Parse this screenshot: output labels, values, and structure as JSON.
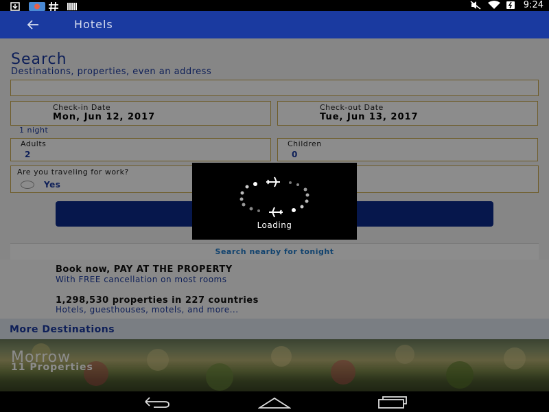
{
  "status_bar": {
    "time": "9:24",
    "icons": [
      "download-icon",
      "photos-icon",
      "hashtag-icon",
      "barcode-icon",
      "mute-icon",
      "wifi-icon",
      "battery-icon"
    ]
  },
  "app_bar": {
    "title": "Hotels",
    "back_icon": "arrow-left-icon",
    "color": "#1a3aa0"
  },
  "search": {
    "title": "Search",
    "subtitle": "Destinations, properties, even an address",
    "destination_value": "",
    "checkin_label": "Check-in Date",
    "checkin_value": "Mon, Jun 12, 2017",
    "checkout_label": "Check-out Date",
    "checkout_value": "Tue, Jun 13, 2017",
    "nights": "1 night",
    "adults_label": "Adults",
    "adults_value": "2",
    "children_label": "Children",
    "children_value": "0",
    "work_question": "Are you traveling for work?",
    "work_option": "Yes",
    "search_button_label": "",
    "nearby_link": "Search nearby for tonight"
  },
  "promo": {
    "headline1": "Book now, PAY AT THE PROPERTY",
    "sub1": "With FREE cancellation on most rooms",
    "headline2": "1,298,530 properties in 227 countries",
    "sub2": "Hotels, guesthouses, motels, and more..."
  },
  "more_destinations": {
    "title": "More Destinations",
    "card": {
      "name": "Morrow",
      "count": "11 Properties"
    }
  },
  "loading": {
    "label": "Loading",
    "icon": "plane-icon"
  },
  "nav_bar": {
    "icons": [
      "back-nav-icon",
      "home-nav-icon",
      "recents-nav-icon"
    ]
  },
  "colors": {
    "accent": "#1a3aa0",
    "field_border": "#c9a84a",
    "link": "#1e78c8"
  }
}
